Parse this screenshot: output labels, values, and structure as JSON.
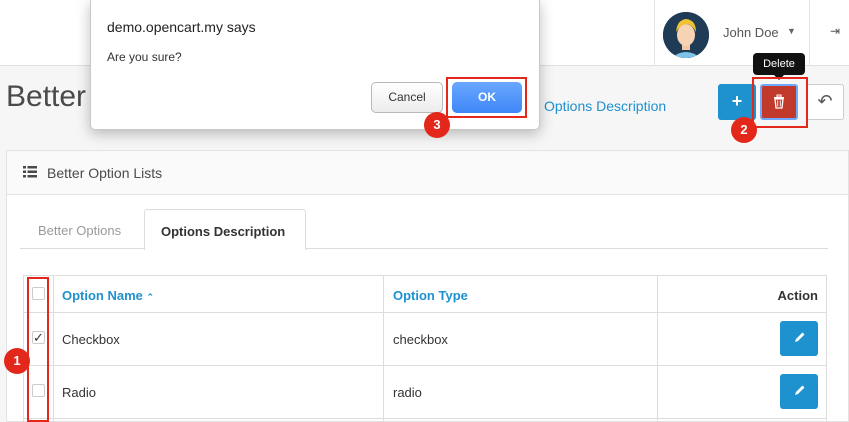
{
  "header": {
    "user_name": "John Doe"
  },
  "page": {
    "title": "Better",
    "breadcrumb_current": "Options Description",
    "delete_tooltip": "Delete"
  },
  "panel": {
    "title": "Better Option Lists",
    "tabs": [
      {
        "label": "Better Options",
        "active": false
      },
      {
        "label": "Options Description",
        "active": true
      }
    ]
  },
  "table": {
    "columns": {
      "name": "Option Name",
      "type": "Option Type",
      "action": "Action"
    },
    "rows": [
      {
        "name": "Checkbox",
        "type": "checkbox",
        "checked": true
      },
      {
        "name": "Radio",
        "type": "radio",
        "checked": false
      }
    ]
  },
  "dialog": {
    "title": "demo.opencart.my says",
    "message": "Are you sure?",
    "cancel_label": "Cancel",
    "ok_label": "OK"
  },
  "annotations": {
    "badge_1": "1",
    "badge_2": "2",
    "badge_3": "3"
  },
  "colors": {
    "primary": "#1e91cf",
    "danger": "#c0392b",
    "highlight": "#e3271b",
    "dialog_ok": "#3f86f7"
  }
}
